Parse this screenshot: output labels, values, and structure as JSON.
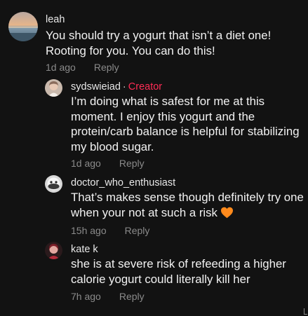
{
  "comments": [
    {
      "username": "leah",
      "is_creator": false,
      "lines": [
        "You should try a yogurt that isn’t a diet one!",
        "Rooting for you. You can do this!"
      ],
      "time": "1d ago",
      "reply_label": "Reply"
    },
    {
      "username": "sydswieiad",
      "is_creator": true,
      "separator": "·",
      "creator_label": "Creator",
      "lines": [
        "I’m doing what is safest for me at this",
        "moment. I enjoy this yogurt and the",
        "protein/carb balance is helpful for stabilizing",
        "my blood sugar."
      ],
      "time": "1d ago",
      "reply_label": "Reply"
    },
    {
      "username": "doctor_who_enthusiast",
      "is_creator": false,
      "lines": [
        "That’s makes sense though definitely try one",
        "when your not at such a risk"
      ],
      "emoji": "orange-heart",
      "time": "15h ago",
      "reply_label": "Reply"
    },
    {
      "username": "kate k",
      "is_creator": false,
      "lines": [
        "she is at severe risk of refeeding a higher",
        "calorie yogurt could literally kill her"
      ],
      "time": "7h ago",
      "reply_label": "Reply"
    }
  ],
  "colors": {
    "background": "#121212",
    "text": "#f2f2f2",
    "muted": "#8a8a8a",
    "creator": "#fe2c55",
    "heart": "#ff8a1c"
  }
}
